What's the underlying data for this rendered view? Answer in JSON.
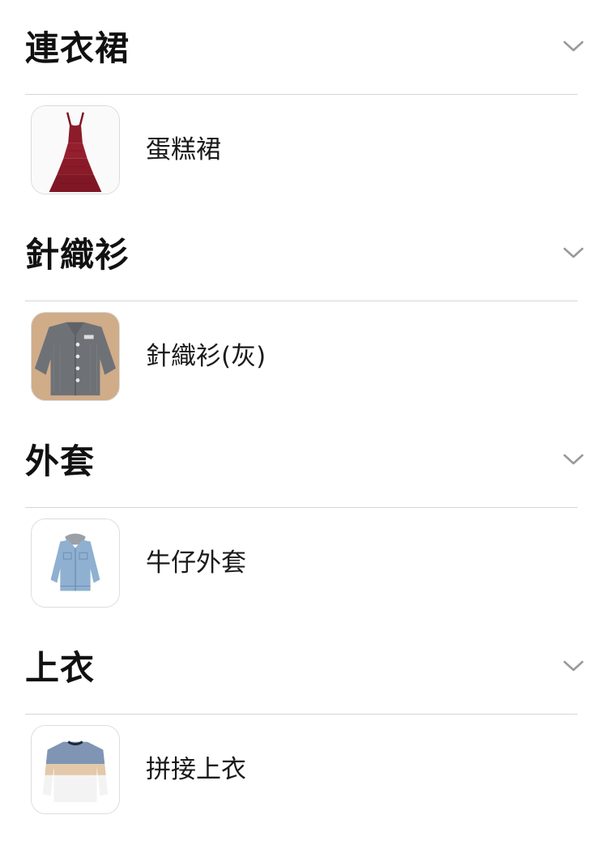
{
  "sections": [
    {
      "title": "連衣裙",
      "item": {
        "label": "蛋糕裙",
        "image": "red-tiered-dress-photo"
      }
    },
    {
      "title": "針織衫",
      "item": {
        "label": "針織衫(灰)",
        "image": "gray-knit-cardigan-photo"
      }
    },
    {
      "title": "外套",
      "item": {
        "label": "牛仔外套",
        "image": "denim-jacket-photo"
      }
    },
    {
      "title": "上衣",
      "item": {
        "label": "拼接上衣",
        "image": "color-block-sweater-photo"
      }
    }
  ],
  "icons": {
    "expand": "chevron-down-icon"
  },
  "colors": {
    "divider": "#d6d6d6",
    "chevron": "#9a9a9a",
    "text": "#111111"
  }
}
